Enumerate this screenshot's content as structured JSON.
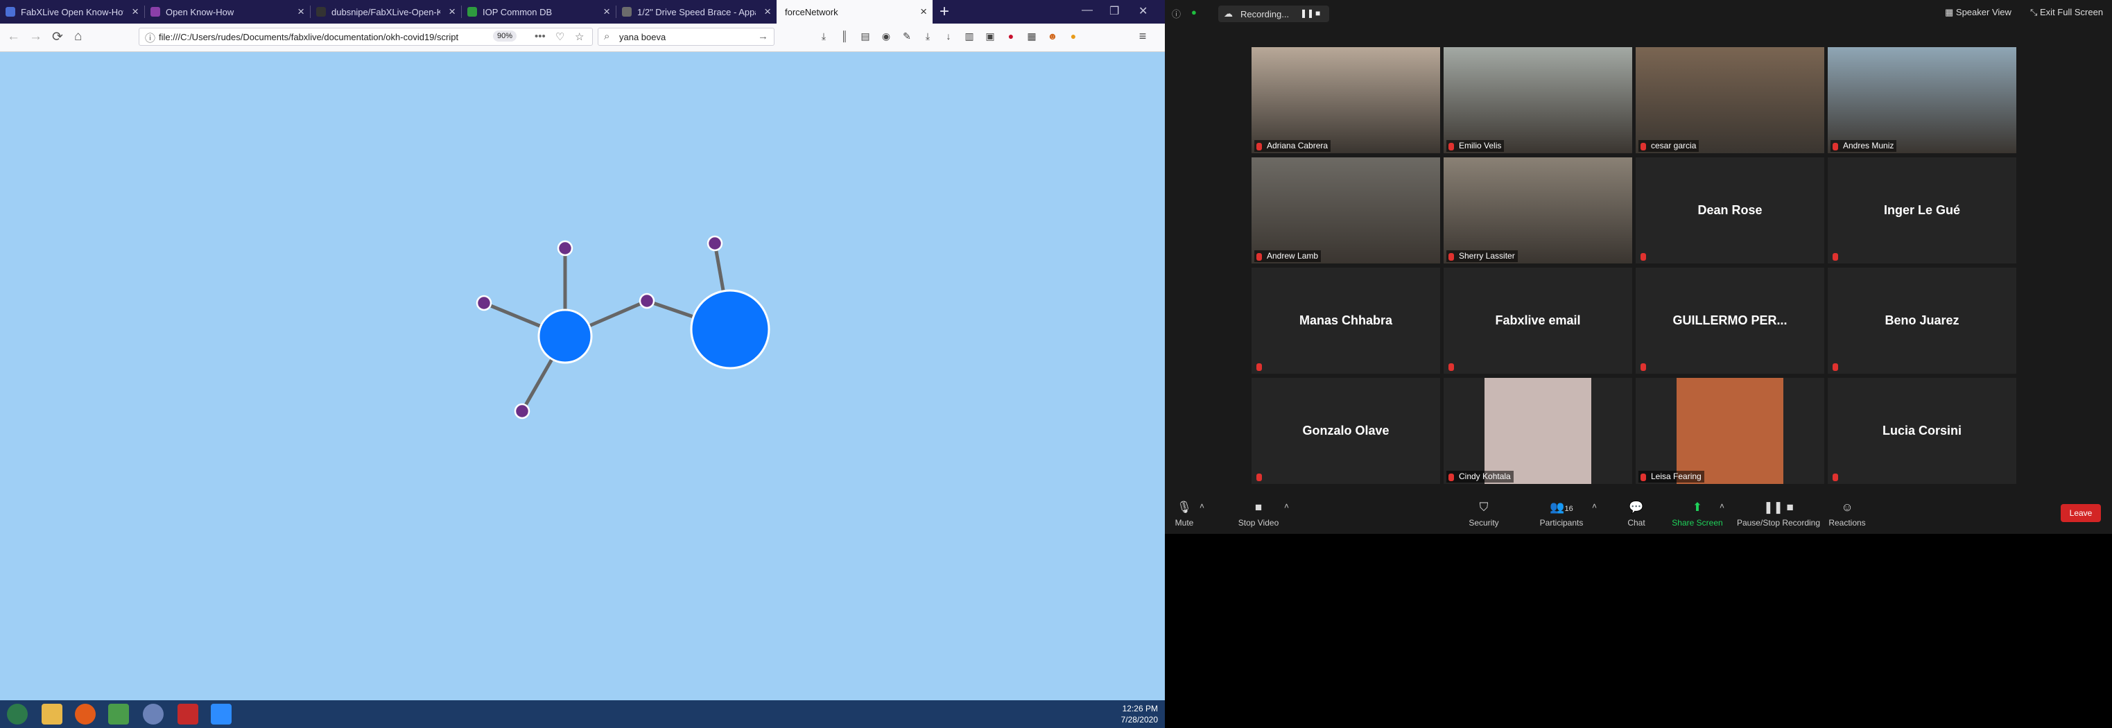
{
  "browser": {
    "tabs": [
      {
        "title": "FabXLive Open Know-How Worksh",
        "favicon_color": "#4a6fd6"
      },
      {
        "title": "Open Know-How",
        "favicon_color": "#8b3fa8"
      },
      {
        "title": "dubsnipe/FabXLive-Open-Know",
        "favicon_color": "#333333"
      },
      {
        "title": "IOP Common DB",
        "favicon_color": "#2e9b3f"
      },
      {
        "title": "1/2\" Drive Speed Brace - Appa",
        "favicon_color": "#6c6c6c"
      },
      {
        "title": "forceNetwork",
        "favicon_color": "#ffffff"
      }
    ],
    "active_tab": 5,
    "new_tab": "+",
    "window_controls": [
      "—",
      "❐",
      "✕"
    ],
    "nav": {
      "back": "←",
      "forward": "→",
      "reload": "⟳",
      "home": "⌂"
    },
    "url": "file:///C:/Users/rudes/Documents/fabxlive/documentation/okh-covid19/script",
    "zoom_level": "90%",
    "url_icons": [
      "•••",
      "♡",
      "☆"
    ],
    "search_value": "yana boeva",
    "search_go": "→",
    "toolbar_icons": [
      "⤓",
      "║",
      "▤",
      "◉",
      "✎",
      "⤓",
      "↓",
      "▥",
      "▣",
      "●",
      "▦",
      "☻",
      "●"
    ],
    "menu": "≡"
  },
  "graph": {
    "node_color_big": "#0a74ff",
    "node_color_small": "#6b2f86",
    "link_color": "#666666"
  },
  "taskbar": {
    "time": "12:26 PM",
    "date": "7/28/2020"
  },
  "zoom": {
    "recording_label": "Recording...",
    "speaker_view": "Speaker View",
    "exit_full_screen": "Exit Full Screen",
    "participants": [
      {
        "name": "Adriana Cabrera",
        "type": "video",
        "bg": "#b8a898"
      },
      {
        "name": "Emilio Velis",
        "type": "video",
        "bg": "#a3a9a4"
      },
      {
        "name": "cesar garcia",
        "type": "video",
        "bg": "#7a6552",
        "active": true
      },
      {
        "name": "Andres Muniz",
        "type": "video",
        "bg": "#8fa6b5"
      },
      {
        "name": "Andrew Lamb",
        "type": "video",
        "bg": "#6d6a64"
      },
      {
        "name": "Sherry Lassiter",
        "type": "video",
        "bg": "#8a8175"
      },
      {
        "name": "Dean Rose",
        "type": "name"
      },
      {
        "name": "Inger Le Gué",
        "type": "name"
      },
      {
        "name": "Manas Chhabra",
        "type": "name"
      },
      {
        "name": "Fabxlive email",
        "type": "name"
      },
      {
        "name": "GUILLERMO  PER...",
        "type": "name"
      },
      {
        "name": "Beno Juarez",
        "type": "name"
      },
      {
        "name": "Gonzalo Olave",
        "type": "name"
      },
      {
        "name": "Cindy Kohtala",
        "type": "avatar",
        "bg": "#c9b8b4"
      },
      {
        "name": "Leisa Fearing",
        "type": "avatar",
        "bg": "#b9623a"
      },
      {
        "name": "Lucia Corsini",
        "type": "name"
      }
    ],
    "controls": {
      "mute": "Mute",
      "stop_video": "Stop Video",
      "security": "Security",
      "participants": "Participants",
      "participants_count": "16",
      "chat": "Chat",
      "share_screen": "Share Screen",
      "pause_stop_recording": "Pause/Stop Recording",
      "reactions": "Reactions",
      "leave": "Leave"
    }
  }
}
